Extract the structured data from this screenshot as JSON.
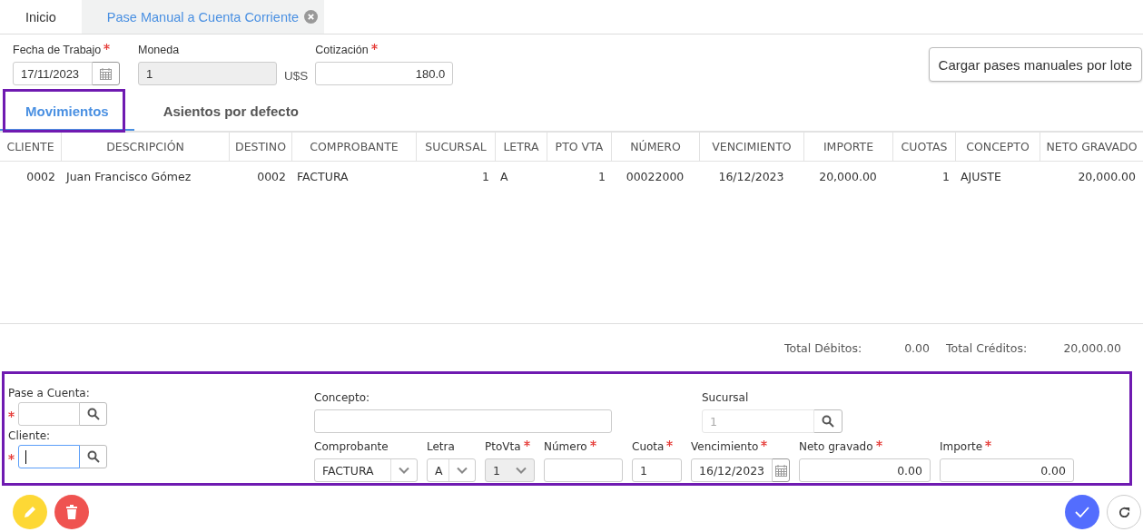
{
  "top_tabs": [
    {
      "label": "Inicio",
      "selected": false,
      "closable": false
    },
    {
      "label": "Pase Manual a Cuenta Corriente",
      "selected": true,
      "closable": true
    }
  ],
  "header": {
    "fields": [
      {
        "kind": "date",
        "label": "Fecha de Trabajo",
        "required": true,
        "value": "17/11/2023",
        "disabled": false
      },
      {
        "kind": "text",
        "label": "Moneda",
        "required": false,
        "value": "1",
        "disabled": true
      },
      {
        "kind": "number",
        "label": "Cotización",
        "required": true,
        "value": "180.0",
        "disabled": false
      }
    ],
    "currency_label": "U$S",
    "button": "Cargar pases manuales por lote"
  },
  "tabs": [
    {
      "label": "Movimientos",
      "selected": true,
      "highlighted": true
    },
    {
      "label": "Asientos por defecto",
      "selected": false,
      "highlighted": false
    }
  ],
  "table": {
    "columns": [
      "CLIENTE",
      "DESCRIPCIÓN",
      "DESTINO",
      "COMPROBANTE",
      "SUCURSAL",
      "LETRA",
      "PTO VTA",
      "NÚMERO",
      "VENCIMIENTO",
      "IMPORTE",
      "CUOTAS",
      "CONCEPTO",
      "NETO GRAVADO"
    ],
    "rows": [
      [
        "0002",
        "Juan Francisco Gómez",
        "0002",
        "FACTURA",
        "1",
        "A",
        "1",
        "00022000",
        "16/12/2023",
        "20,000.00",
        "1",
        "AJUSTE",
        "20,000.00"
      ]
    ]
  },
  "totals": [
    {
      "label": "Total Débitos:",
      "value": "0.00"
    },
    {
      "label": "Total Créditos:",
      "value": "20,000.00"
    }
  ],
  "form": {
    "highlighted": true,
    "accounts": [
      {
        "kind": "lookup",
        "label": "Pase a Cuenta:",
        "required": true,
        "focused": false
      },
      {
        "kind": "lookup",
        "label": "Cliente:",
        "required": true,
        "focused": true
      }
    ],
    "top_row": [
      {
        "kind": "text",
        "label": "Concepto:",
        "required": false,
        "disabled": false
      },
      {
        "kind": "lookup",
        "label": "Sucursal",
        "required": false,
        "value": "1",
        "disabled": true
      }
    ],
    "bottom_row": [
      {
        "kind": "select",
        "label": "Comprobante",
        "required": false,
        "value": "FACTURA",
        "disabled": false
      },
      {
        "kind": "select",
        "label": "Letra",
        "required": false,
        "value": "A",
        "disabled": false
      },
      {
        "kind": "select",
        "label": "PtoVta",
        "required": true,
        "value": "1",
        "disabled": true
      },
      {
        "kind": "text",
        "label": "Número",
        "required": true,
        "disabled": false
      },
      {
        "kind": "text",
        "label": "Cuota",
        "required": true,
        "value": "1",
        "disabled": false
      },
      {
        "kind": "date",
        "label": "Vencimiento",
        "required": true,
        "value": "16/12/2023",
        "disabled": false
      },
      {
        "kind": "number",
        "label": "Neto gravado",
        "required": true,
        "value": "0.00",
        "disabled": false
      },
      {
        "kind": "number",
        "label": "Importe",
        "required": true,
        "value": "0.00",
        "disabled": false
      }
    ]
  },
  "actions": [
    {
      "kind": "edit"
    },
    {
      "kind": "delete"
    },
    {
      "kind": "confirm"
    },
    {
      "kind": "refresh"
    }
  ]
}
